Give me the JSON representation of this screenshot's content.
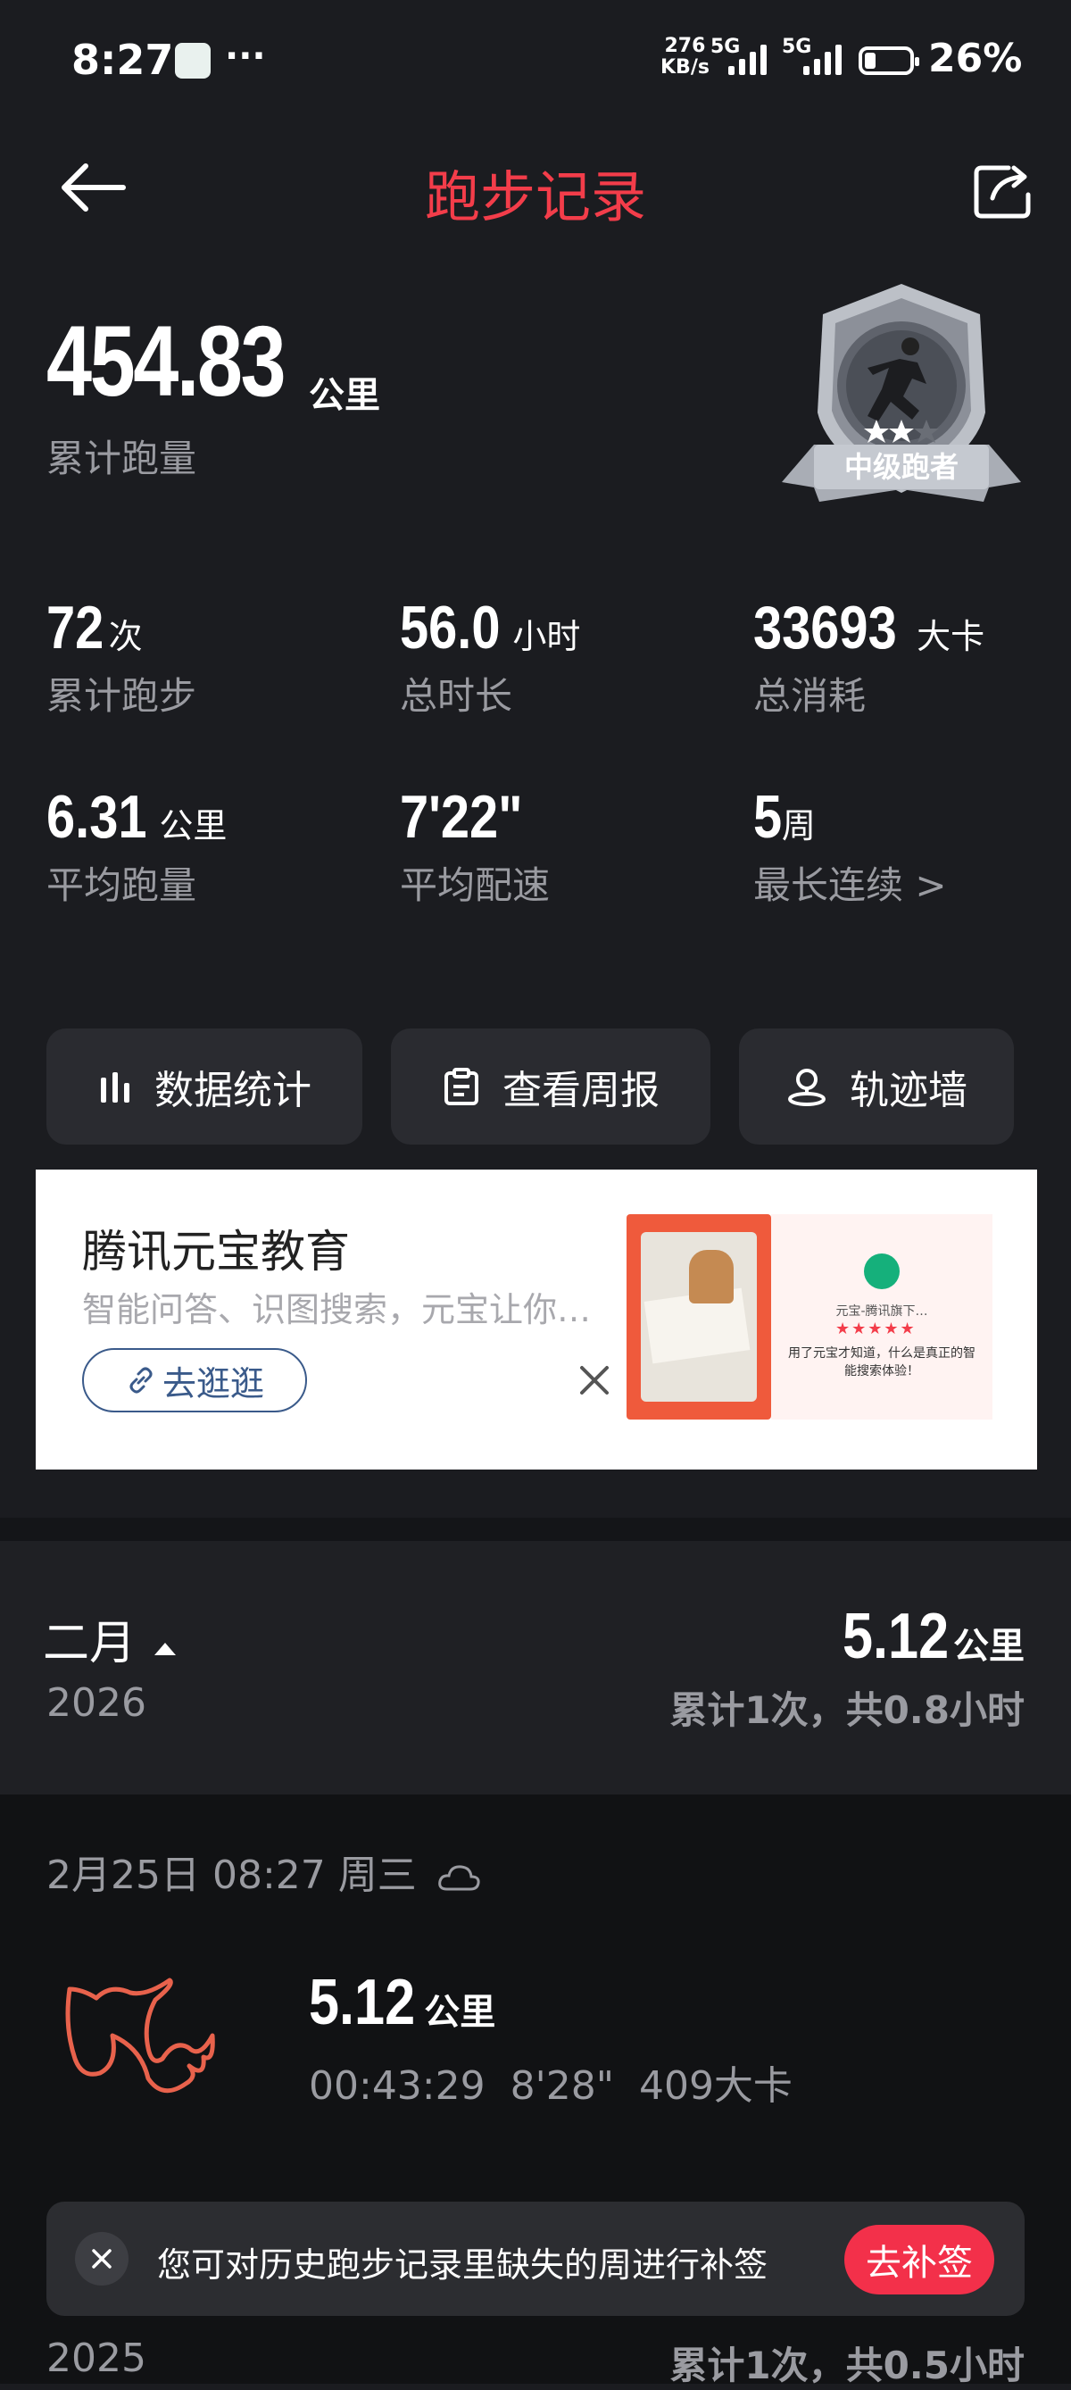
{
  "status": {
    "time": "8:27",
    "dots": "···",
    "net_speed_value": "276",
    "net_speed_unit": "KB/s",
    "sim1": "5G",
    "sim2": "5G",
    "battery_level": 0.26,
    "battery": "26%"
  },
  "header": {
    "title": "跑步记录",
    "back_icon": "arrow-left-icon",
    "share_icon": "share-icon"
  },
  "summary": {
    "total_distance": "454.83",
    "total_unit": "公里",
    "total_label": "累计跑量",
    "badge_label": "中级跑者",
    "stats": [
      {
        "value": "72",
        "unit": "次",
        "label": "累计跑步"
      },
      {
        "value": "56.0",
        "unit": "小时",
        "label": "总时长"
      },
      {
        "value": "33693",
        "unit": "大卡",
        "label": "总消耗"
      },
      {
        "value": "6.31",
        "unit": "公里",
        "label": "平均跑量"
      },
      {
        "value": "7'22\"",
        "unit": "",
        "label": "平均配速"
      },
      {
        "value": "5",
        "unit": "周",
        "label": "最长连续 >"
      }
    ]
  },
  "actions": [
    {
      "label": "数据统计",
      "icon": "bar-chart-icon"
    },
    {
      "label": "查看周报",
      "icon": "clipboard-icon"
    },
    {
      "label": "轨迹墙",
      "icon": "location-pin-icon"
    }
  ],
  "ad": {
    "title": "腾讯元宝教育",
    "subtitle": "智能问答、识图搜索，元宝让你…",
    "button": "去逛逛",
    "card_title": "元宝-腾讯旗下…",
    "card_text": "用了元宝才知道，什么是真正的智能搜索体验！"
  },
  "month": {
    "name": "二月",
    "year": "2026",
    "distance": "5.12",
    "unit": "公里",
    "summary": "累计1次，共0.8小时"
  },
  "run": {
    "date": "2月25日  08:27  周三",
    "weather_icon": "cloud-icon",
    "distance": "5.12",
    "unit": "公里",
    "duration": "00:43:29",
    "pace": "8'28\"",
    "calories": "409大卡"
  },
  "prev_month": {
    "year": "2025",
    "summary": "累计1次，共0.5小时"
  },
  "toast": {
    "text": "您可对历史跑步记录里缺失的周进行补签",
    "button": "去补签"
  }
}
